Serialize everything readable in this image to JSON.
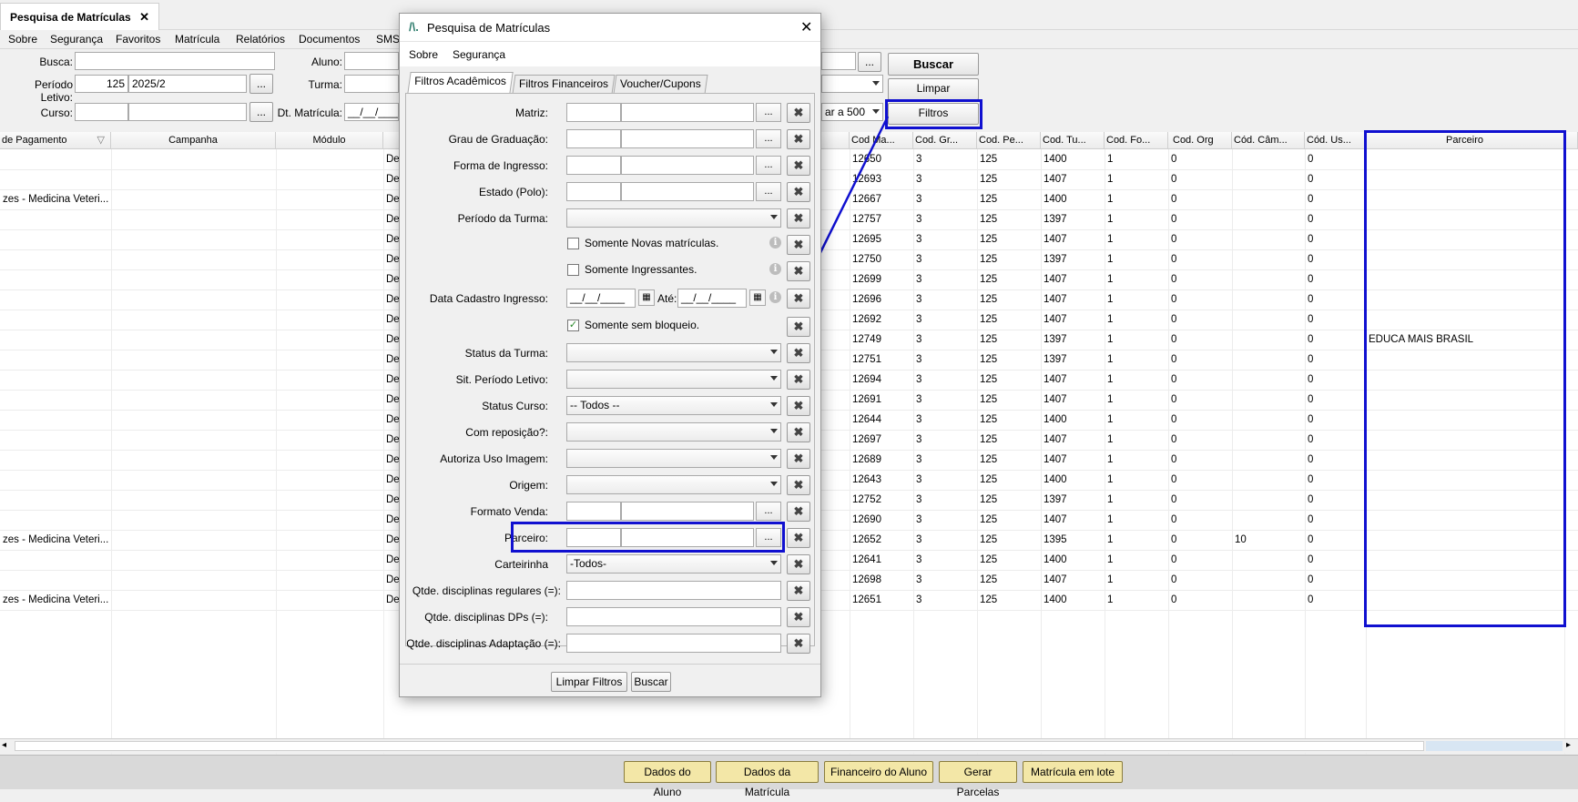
{
  "app": {
    "tab_title": "Pesquisa de Matrículas",
    "tab_close": "✕"
  },
  "menu": [
    "Sobre",
    "Segurança",
    "Favoritos",
    "Matrícula",
    "Relatórios",
    "Documentos",
    "SMS"
  ],
  "form": {
    "busca_label": "Busca:",
    "busca_value": "",
    "periodo_label": "Período Letivo:",
    "periodo_code": "125",
    "periodo_value": "2025/2",
    "periodo_dots": "...",
    "curso_label": "Curso:",
    "curso_dots": "...",
    "aluno_label": "Aluno:",
    "turma_label": "Turma:",
    "dtmatricula_label": "Dt. Matrícula:",
    "dtmatricula_value": "__/__/____",
    "limit_value": "ar a 500",
    "aluno_dots": "..."
  },
  "buttons": {
    "buscar": "Buscar",
    "limpar": "Limpar",
    "filtros": "Filtros"
  },
  "grid": {
    "headers": [
      "de Pagamento",
      "Campanha",
      "Módulo",
      "",
      "Cod Ma...",
      "Cod. Gr...",
      "Cod. Pe...",
      "Cod. Tu...",
      "Cod. Fo...",
      "Cod. Org",
      "Cód. Câm...",
      "Cód. Us...",
      "Parceiro"
    ],
    "rows": [
      {
        "pag": "",
        "de": "De",
        "cod": "12650",
        "gr": "3",
        "pe": "125",
        "tu": "1400",
        "fo": "1",
        "org": "0",
        "cam": "",
        "us": "0",
        "parc": ""
      },
      {
        "pag": "",
        "de": "De",
        "cod": "12693",
        "gr": "3",
        "pe": "125",
        "tu": "1407",
        "fo": "1",
        "org": "0",
        "cam": "",
        "us": "0",
        "parc": ""
      },
      {
        "pag": "zes - Medicina Veteri...",
        "de": "De",
        "cod": "12667",
        "gr": "3",
        "pe": "125",
        "tu": "1400",
        "fo": "1",
        "org": "0",
        "cam": "",
        "us": "0",
        "parc": ""
      },
      {
        "pag": "",
        "de": "De",
        "cod": "12757",
        "gr": "3",
        "pe": "125",
        "tu": "1397",
        "fo": "1",
        "org": "0",
        "cam": "",
        "us": "0",
        "parc": ""
      },
      {
        "pag": "",
        "de": "De",
        "cod": "12695",
        "gr": "3",
        "pe": "125",
        "tu": "1407",
        "fo": "1",
        "org": "0",
        "cam": "",
        "us": "0",
        "parc": ""
      },
      {
        "pag": "",
        "de": "De",
        "cod": "12750",
        "gr": "3",
        "pe": "125",
        "tu": "1397",
        "fo": "1",
        "org": "0",
        "cam": "",
        "us": "0",
        "parc": ""
      },
      {
        "pag": "",
        "de": "De",
        "cod": "12699",
        "gr": "3",
        "pe": "125",
        "tu": "1407",
        "fo": "1",
        "org": "0",
        "cam": "",
        "us": "0",
        "parc": ""
      },
      {
        "pag": "",
        "de": "De",
        "cod": "12696",
        "gr": "3",
        "pe": "125",
        "tu": "1407",
        "fo": "1",
        "org": "0",
        "cam": "",
        "us": "0",
        "parc": ""
      },
      {
        "pag": "",
        "de": "De",
        "cod": "12692",
        "gr": "3",
        "pe": "125",
        "tu": "1407",
        "fo": "1",
        "org": "0",
        "cam": "",
        "us": "0",
        "parc": ""
      },
      {
        "pag": "",
        "de": "De",
        "cod": "12749",
        "gr": "3",
        "pe": "125",
        "tu": "1397",
        "fo": "1",
        "org": "0",
        "cam": "",
        "us": "0",
        "parc": "EDUCA MAIS BRASIL"
      },
      {
        "pag": "",
        "de": "De",
        "cod": "12751",
        "gr": "3",
        "pe": "125",
        "tu": "1397",
        "fo": "1",
        "org": "0",
        "cam": "",
        "us": "0",
        "parc": ""
      },
      {
        "pag": "",
        "de": "De",
        "cod": "12694",
        "gr": "3",
        "pe": "125",
        "tu": "1407",
        "fo": "1",
        "org": "0",
        "cam": "",
        "us": "0",
        "parc": ""
      },
      {
        "pag": "",
        "de": "De",
        "cod": "12691",
        "gr": "3",
        "pe": "125",
        "tu": "1407",
        "fo": "1",
        "org": "0",
        "cam": "",
        "us": "0",
        "parc": ""
      },
      {
        "pag": "",
        "de": "De",
        "cod": "12644",
        "gr": "3",
        "pe": "125",
        "tu": "1400",
        "fo": "1",
        "org": "0",
        "cam": "",
        "us": "0",
        "parc": ""
      },
      {
        "pag": "",
        "de": "De",
        "cod": "12697",
        "gr": "3",
        "pe": "125",
        "tu": "1407",
        "fo": "1",
        "org": "0",
        "cam": "",
        "us": "0",
        "parc": ""
      },
      {
        "pag": "",
        "de": "De",
        "cod": "12689",
        "gr": "3",
        "pe": "125",
        "tu": "1407",
        "fo": "1",
        "org": "0",
        "cam": "",
        "us": "0",
        "parc": ""
      },
      {
        "pag": "",
        "de": "De",
        "cod": "12643",
        "gr": "3",
        "pe": "125",
        "tu": "1400",
        "fo": "1",
        "org": "0",
        "cam": "",
        "us": "0",
        "parc": ""
      },
      {
        "pag": "",
        "de": "De",
        "cod": "12752",
        "gr": "3",
        "pe": "125",
        "tu": "1397",
        "fo": "1",
        "org": "0",
        "cam": "",
        "us": "0",
        "parc": ""
      },
      {
        "pag": "",
        "de": "De",
        "cod": "12690",
        "gr": "3",
        "pe": "125",
        "tu": "1407",
        "fo": "1",
        "org": "0",
        "cam": "",
        "us": "0",
        "parc": ""
      },
      {
        "pag": "zes - Medicina Veteri...",
        "de": "De",
        "cod": "12652",
        "gr": "3",
        "pe": "125",
        "tu": "1395",
        "fo": "1",
        "org": "0",
        "cam": "10",
        "us": "0",
        "parc": ""
      },
      {
        "pag": "",
        "de": "De",
        "cod": "12641",
        "gr": "3",
        "pe": "125",
        "tu": "1400",
        "fo": "1",
        "org": "0",
        "cam": "",
        "us": "0",
        "parc": ""
      },
      {
        "pag": "",
        "de": "De",
        "cod": "12698",
        "gr": "3",
        "pe": "125",
        "tu": "1407",
        "fo": "1",
        "org": "0",
        "cam": "",
        "us": "0",
        "parc": ""
      },
      {
        "pag": "zes - Medicina Veteri...",
        "de": "De",
        "cod": "12651",
        "gr": "3",
        "pe": "125",
        "tu": "1400",
        "fo": "1",
        "org": "0",
        "cam": "",
        "us": "0",
        "parc": ""
      }
    ]
  },
  "footer_buttons": [
    "Dados do Aluno",
    "Dados da Matrícula",
    "Financeiro do Aluno",
    "Gerar Parcelas",
    "Matrícula em lote"
  ],
  "dialog": {
    "title": "Pesquisa de Matrículas",
    "close": "✕",
    "menu": [
      "Sobre",
      "Segurança"
    ],
    "tabs": [
      "Filtros Acadêmicos",
      "Filtros Financeiros",
      "Voucher/Cupons"
    ],
    "fields": {
      "matriz": "Matriz:",
      "grau": "Grau de Graduação:",
      "forma": "Forma de Ingresso:",
      "estado": "Estado (Polo):",
      "periodo_turma": "Período da Turma:",
      "novas": "Somente Novas matrículas.",
      "ingressantes": "Somente Ingressantes.",
      "data_cadastro": "Data Cadastro Ingresso:",
      "data_de": "__/__/____",
      "ate": "Até:",
      "data_ate": "__/__/____",
      "sem_bloqueio": "Somente sem bloqueio.",
      "status_turma": "Status da Turma:",
      "sit_periodo": "Sit. Período Letivo:",
      "status_curso": "Status Curso:",
      "status_curso_value": "-- Todos --",
      "reposicao": "Com reposição?:",
      "imagem": "Autoriza Uso Imagem:",
      "origem": "Origem:",
      "formato": "Formato Venda:",
      "parceiro": "Parceiro:",
      "carteirinha": "Carteirinha",
      "carteirinha_value": "-Todos-",
      "qtde_regulares": "Qtde. disciplinas regulares (=):",
      "qtde_dps": "Qtde. disciplinas DPs (=):",
      "qtde_adaptacao": "Qtde. disciplinas Adaptação (=):",
      "dots": "...",
      "clear": "✖",
      "check": "✓",
      "info": "i",
      "cal": "▦"
    },
    "foot_buttons": {
      "limpar": "Limpar Filtros",
      "buscar": "Buscar"
    }
  },
  "colors": {
    "highlight": "#1010d0",
    "footer_button": "#f3e7a7"
  }
}
